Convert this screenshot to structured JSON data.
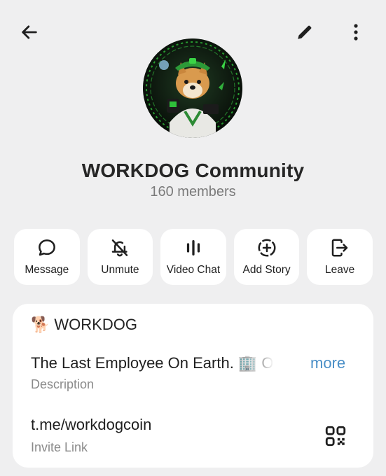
{
  "header": {
    "back_icon": "arrow-left-icon",
    "edit_icon": "pencil-icon",
    "more_icon": "more-vertical-icon"
  },
  "profile": {
    "name": "WORKDOG Community",
    "members": "160 members",
    "avatar": "shiba-dog-office-worker-avatar"
  },
  "actions": [
    {
      "label": "Message",
      "icon": "chat-bubble-icon"
    },
    {
      "label": "Unmute",
      "icon": "bell-off-icon"
    },
    {
      "label": "Video Chat",
      "icon": "voice-bars-icon"
    },
    {
      "label": "Add Story",
      "icon": "story-plus-icon"
    },
    {
      "label": "Leave",
      "icon": "leave-icon"
    }
  ],
  "info": {
    "group_name": "WORKDOG",
    "group_emoji": "🐕",
    "description": "The Last Employee On Earth. 🏢 O",
    "more_label": "more",
    "description_label": "Description",
    "invite_link": "t.me/workdogcoin",
    "invite_label": "Invite Link",
    "qr_icon": "qr-code-icon"
  },
  "colors": {
    "background": "#efeff0",
    "card": "#ffffff",
    "link": "#4a8fc7",
    "secondary_text": "#7a7a7a"
  }
}
